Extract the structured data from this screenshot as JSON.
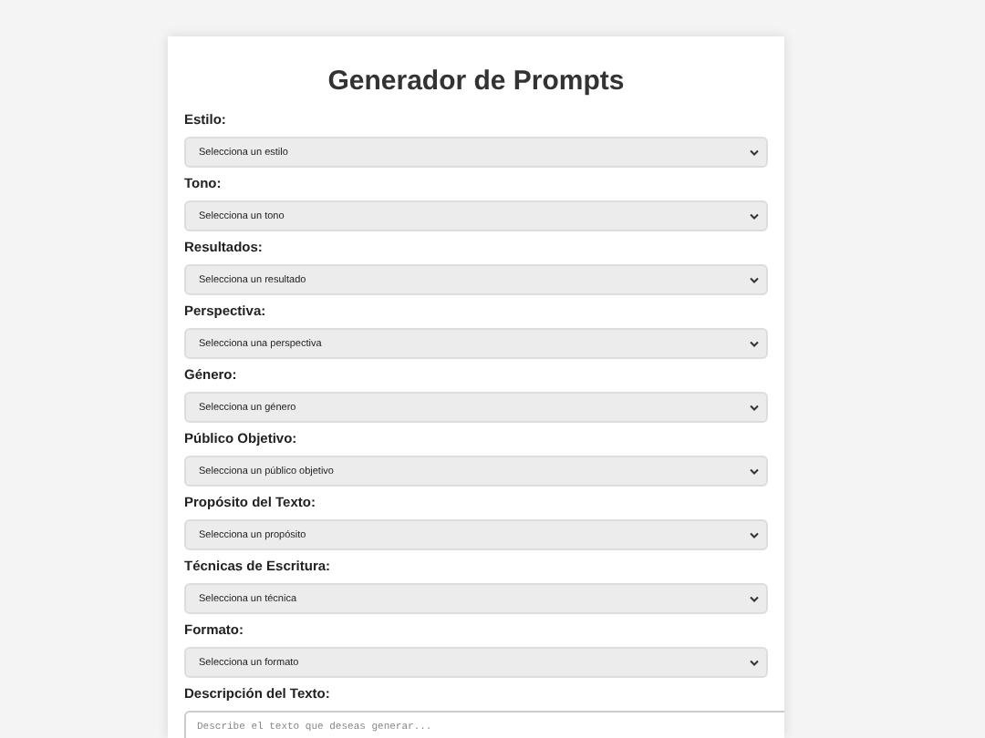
{
  "title": "Generador de Prompts",
  "fields": [
    {
      "label": "Estilo:",
      "value": "Selecciona un estilo"
    },
    {
      "label": "Tono:",
      "value": "Selecciona un tono"
    },
    {
      "label": "Resultados:",
      "value": "Selecciona un resultado"
    },
    {
      "label": "Perspectiva:",
      "value": "Selecciona una perspectiva"
    },
    {
      "label": "Género:",
      "value": "Selecciona un género"
    },
    {
      "label": "Público Objetivo:",
      "value": "Selecciona un público objetivo"
    },
    {
      "label": "Propósito del Texto:",
      "value": "Selecciona un propósito"
    },
    {
      "label": "Técnicas de Escritura:",
      "value": "Selecciona un técnica"
    },
    {
      "label": "Formato:",
      "value": "Selecciona un formato"
    }
  ],
  "description": {
    "label": "Descripción del Texto:",
    "placeholder": "Describe el texto que deseas generar..."
  }
}
